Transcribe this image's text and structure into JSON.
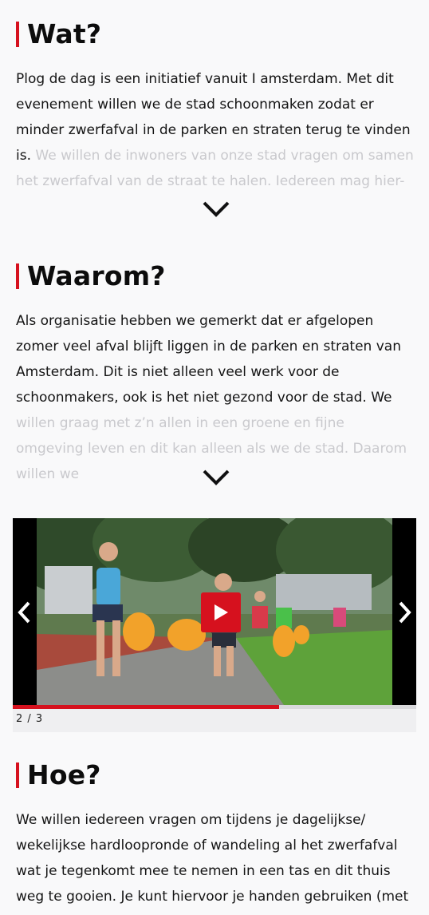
{
  "sections": [
    {
      "title": "Wat?",
      "text": "Plog de dag is een initiatief vanuit I amsterdam. Met dit evenement willen we de stad schoonmaken zodat er minder zwerfafval in de parken en straten terug te vinden is.",
      "text_faded": " We willen de inwoners van onze stad vragen om samen het zwerfafval van de straat te halen. Iedereen mag hier-"
    },
    {
      "title": "Waarom?",
      "text": "Als organisatie hebben we gemerkt dat er afgelopen zomer veel afval blijft liggen in de parken en straten van Amsterdam. Dit is niet alleen veel werk voor de schoonmakers, ook is het niet gezond voor de stad. We",
      "text_faded": " willen graag met z’n allen in een groene en fijne omgeving leven en dit kan alleen als we de stad. Daarom willen we"
    },
    {
      "title": "Hoe?",
      "text": "We willen iedereen vragen om tijdens je dagelijkse/ wekelijkse hardloopronde of wandeling al het zwerfafval wat je tegenkomt mee te nemen in een tas en dit thuis weg te gooien. Je kunt hiervoor je handen gebruiken (met",
      "text_faded": ""
    }
  ],
  "icons": {
    "expand": "chevron-down-icon",
    "prev": "chevron-left-icon",
    "next": "chevron-right-icon",
    "play": "play-icon"
  },
  "carousel": {
    "counter": "2 / 3",
    "progress": 0.66,
    "accent": "#d6111e"
  }
}
